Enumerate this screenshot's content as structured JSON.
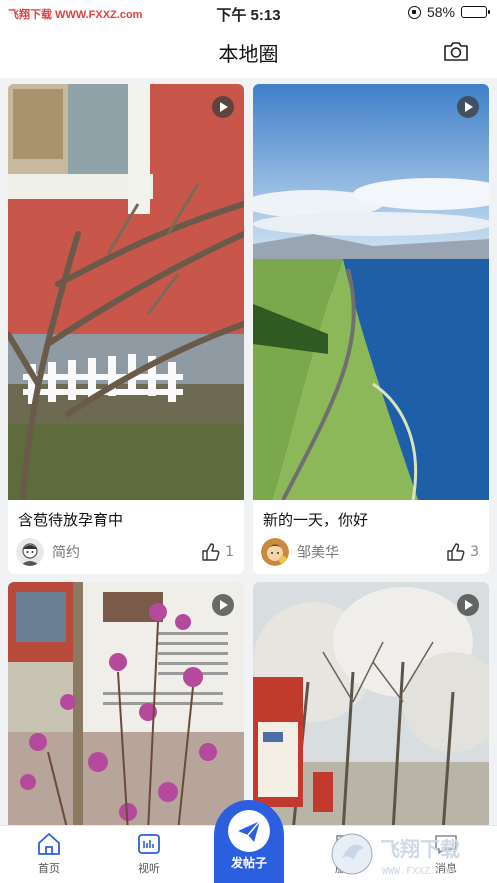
{
  "status_bar": {
    "carrier": "飞翔下载 WWW.FXXZ.com",
    "time": "下午 5:13",
    "battery": "58%",
    "battery_level": 0.58
  },
  "header": {
    "title": "本地圈",
    "camera_icon": "camera-icon"
  },
  "posts": [
    {
      "caption": "含苞待放孕育中",
      "author": "简约",
      "likes": "1",
      "video": true
    },
    {
      "caption": "新的一天，你好",
      "author": "邹美华",
      "likes": "3",
      "video": true
    },
    {
      "caption": "",
      "author": "",
      "likes": "",
      "video": true
    },
    {
      "caption": "",
      "author": "",
      "likes": "",
      "video": true
    }
  ],
  "tabbar": {
    "home": "首页",
    "watch": "视听",
    "post": "发帖子",
    "service": "服务",
    "messages": "消息"
  },
  "watermark": {
    "title": "飞翔下载",
    "url": "WWW.FXXZ.COM"
  },
  "colors": {
    "accent": "#2c5fe0",
    "text": "#222222",
    "muted": "#888888"
  }
}
